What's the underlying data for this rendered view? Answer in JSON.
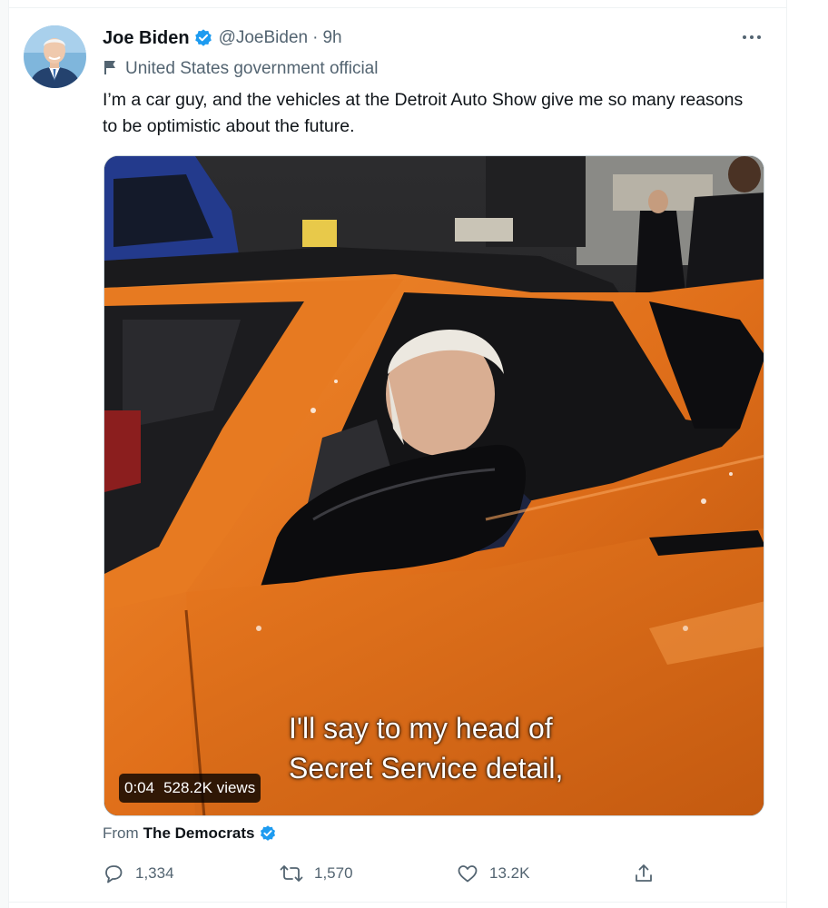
{
  "tweet": {
    "author": {
      "name": "Joe Biden",
      "handle": "@JoeBiden",
      "separator": "·",
      "time": "9h",
      "verified": true,
      "affiliation": "United States government official"
    },
    "text": "I’m a car guy, and the vehicles at the Detroit Auto Show give me so many reasons to be optimistic about the future.",
    "media": {
      "caption_line1": "I'll say to my head of",
      "caption_line2": "Secret Service detail,",
      "duration": "0:04",
      "views": "528.2K views"
    },
    "source": {
      "label": "From",
      "name": "The Democrats",
      "verified": true
    },
    "stats": {
      "replies": "1,334",
      "retweets": "1,570",
      "likes": "13.2K"
    }
  },
  "colors": {
    "verified": "#1d9bf0",
    "secondary_text": "#536471",
    "primary_text": "#0f1419",
    "car_orange": "#e2711c"
  },
  "icons": [
    "more-icon",
    "verified-icon",
    "government-flag-icon",
    "reply-icon",
    "retweet-icon",
    "like-icon",
    "share-icon"
  ]
}
